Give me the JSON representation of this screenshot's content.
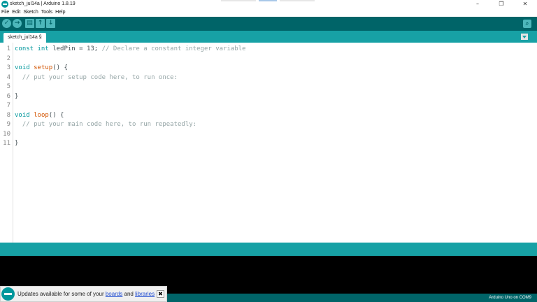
{
  "window": {
    "title": "sketch_jul14a | Arduino 1.8.19",
    "controls": [
      "–",
      "❐",
      "✕"
    ]
  },
  "menu": [
    "File",
    "Edit",
    "Sketch",
    "Tools",
    "Help"
  ],
  "toolbar": {
    "verify_icon": "✓",
    "upload_icon": "→",
    "new_icon": "▤",
    "open_icon": "↑",
    "save_icon": "↓",
    "serial_icon": "⌕"
  },
  "tab": {
    "label": "sketch_jul14a §"
  },
  "editor": {
    "line_numbers": [
      "1",
      "2",
      "3",
      "4",
      "5",
      "6",
      "7",
      "8",
      "9",
      "10",
      "11"
    ],
    "lines": [
      {
        "kw": "const int",
        "rest": " ledPin = 13; ",
        "cm": "// Declare a constant integer variable"
      },
      {
        "kw": "",
        "rest": "",
        "cm": ""
      },
      {
        "kw": "void",
        "fn": " setup",
        "rest": "() {",
        "cm": ""
      },
      {
        "kw": "",
        "rest": "  ",
        "cm": "// put your setup code here, to run once:"
      },
      {
        "kw": "",
        "rest": "",
        "cm": ""
      },
      {
        "kw": "",
        "rest": "}",
        "cm": ""
      },
      {
        "kw": "",
        "rest": "",
        "cm": ""
      },
      {
        "kw": "void",
        "fn": " loop",
        "rest": "() {",
        "cm": ""
      },
      {
        "kw": "",
        "rest": "  ",
        "cm": "// put your main code here, to run repeatedly:"
      },
      {
        "kw": "",
        "rest": "",
        "cm": ""
      },
      {
        "kw": "",
        "rest": "}",
        "cm": ""
      }
    ]
  },
  "status": {
    "board": "Arduino Uno on COM9"
  },
  "notification": {
    "prefix": "Updates available for some of your ",
    "link1": "boards",
    "middle": " and ",
    "link2": "libraries",
    "close": "✖"
  },
  "colors": {
    "toolbar": "#006468",
    "tabbar": "#17a1a5",
    "keyword": "#00979c",
    "function": "#d35400",
    "comment": "#95a5a6"
  }
}
